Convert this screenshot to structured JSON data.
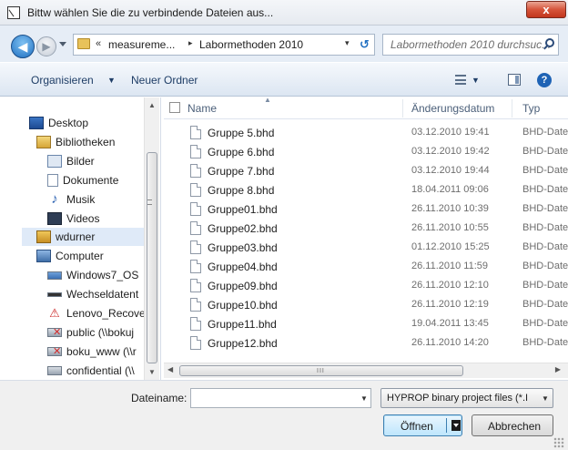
{
  "window": {
    "title": "Bittw wählen Sie die zu verbindende Dateien aus...",
    "close_glyph": "x"
  },
  "address": {
    "overflow_glyph": "«",
    "crumbs": [
      "measureme...",
      "Labormethoden 2010"
    ],
    "separator": "▸",
    "dropdown_glyph": "▾",
    "refresh_glyph": "↺",
    "search_placeholder": "Labormethoden 2010 durchsuc..."
  },
  "toolbar": {
    "organize": "Organisieren",
    "organize_caret": "▼",
    "new_folder": "Neuer Ordner",
    "views_caret": "▼",
    "help": "?"
  },
  "nav": {
    "items": [
      {
        "label": "Desktop",
        "icon": "desktop-icon"
      },
      {
        "label": "Bibliotheken",
        "icon": "libraries-icon"
      },
      {
        "label": "Bilder",
        "icon": "pictures-icon"
      },
      {
        "label": "Dokumente",
        "icon": "documents-icon"
      },
      {
        "label": "Musik",
        "icon": "music-icon"
      },
      {
        "label": "Videos",
        "icon": "videos-icon"
      },
      {
        "label": "wdurner",
        "icon": "user-folder-icon"
      },
      {
        "label": "Computer",
        "icon": "computer-icon"
      },
      {
        "label": "Windows7_OS",
        "icon": "drive-icon"
      },
      {
        "label": "Wechseldatent",
        "icon": "removable-drive-icon"
      },
      {
        "label": "Lenovo_Recove",
        "icon": "recovery-drive-icon"
      },
      {
        "label": "public (\\\\bokuj",
        "icon": "network-drive-icon"
      },
      {
        "label": "boku_www (\\\\r",
        "icon": "network-drive-icon"
      },
      {
        "label": "confidential (\\\\",
        "icon": "network-drive-icon"
      }
    ]
  },
  "files": {
    "columns": {
      "name": "Name",
      "date": "Änderungsdatum",
      "type": "Typ"
    },
    "rows": [
      {
        "name": "Gruppe 5.bhd",
        "date": "03.12.2010 19:41",
        "type": "BHD-Date"
      },
      {
        "name": "Gruppe 6.bhd",
        "date": "03.12.2010 19:42",
        "type": "BHD-Date"
      },
      {
        "name": "Gruppe 7.bhd",
        "date": "03.12.2010 19:44",
        "type": "BHD-Date"
      },
      {
        "name": "Gruppe 8.bhd",
        "date": "18.04.2011 09:06",
        "type": "BHD-Date"
      },
      {
        "name": "Gruppe01.bhd",
        "date": "26.11.2010 10:39",
        "type": "BHD-Date"
      },
      {
        "name": "Gruppe02.bhd",
        "date": "26.11.2010 10:55",
        "type": "BHD-Date"
      },
      {
        "name": "Gruppe03.bhd",
        "date": "01.12.2010 15:25",
        "type": "BHD-Date"
      },
      {
        "name": "Gruppe04.bhd",
        "date": "26.11.2010 11:59",
        "type": "BHD-Date"
      },
      {
        "name": "Gruppe09.bhd",
        "date": "26.11.2010 12:10",
        "type": "BHD-Date"
      },
      {
        "name": "Gruppe10.bhd",
        "date": "26.11.2010 12:19",
        "type": "BHD-Date"
      },
      {
        "name": "Gruppe11.bhd",
        "date": "19.04.2011 13:45",
        "type": "BHD-Date"
      },
      {
        "name": "Gruppe12.bhd",
        "date": "26.11.2010 14:20",
        "type": "BHD-Date"
      }
    ]
  },
  "scroll": {
    "up": "▲",
    "down": "▼",
    "left": "◀",
    "right": "▶",
    "grip": "III"
  },
  "bottom": {
    "filename_label": "Dateiname:",
    "filename_value": "",
    "filter_value": "HYPROP binary project files (*.I",
    "dropdown_glyph": "▼",
    "open": "Öffnen",
    "cancel": "Abbrechen"
  },
  "colors": {
    "accent": "#1e63b5",
    "close": "#c2361d",
    "selection": "#dfeaf8"
  }
}
